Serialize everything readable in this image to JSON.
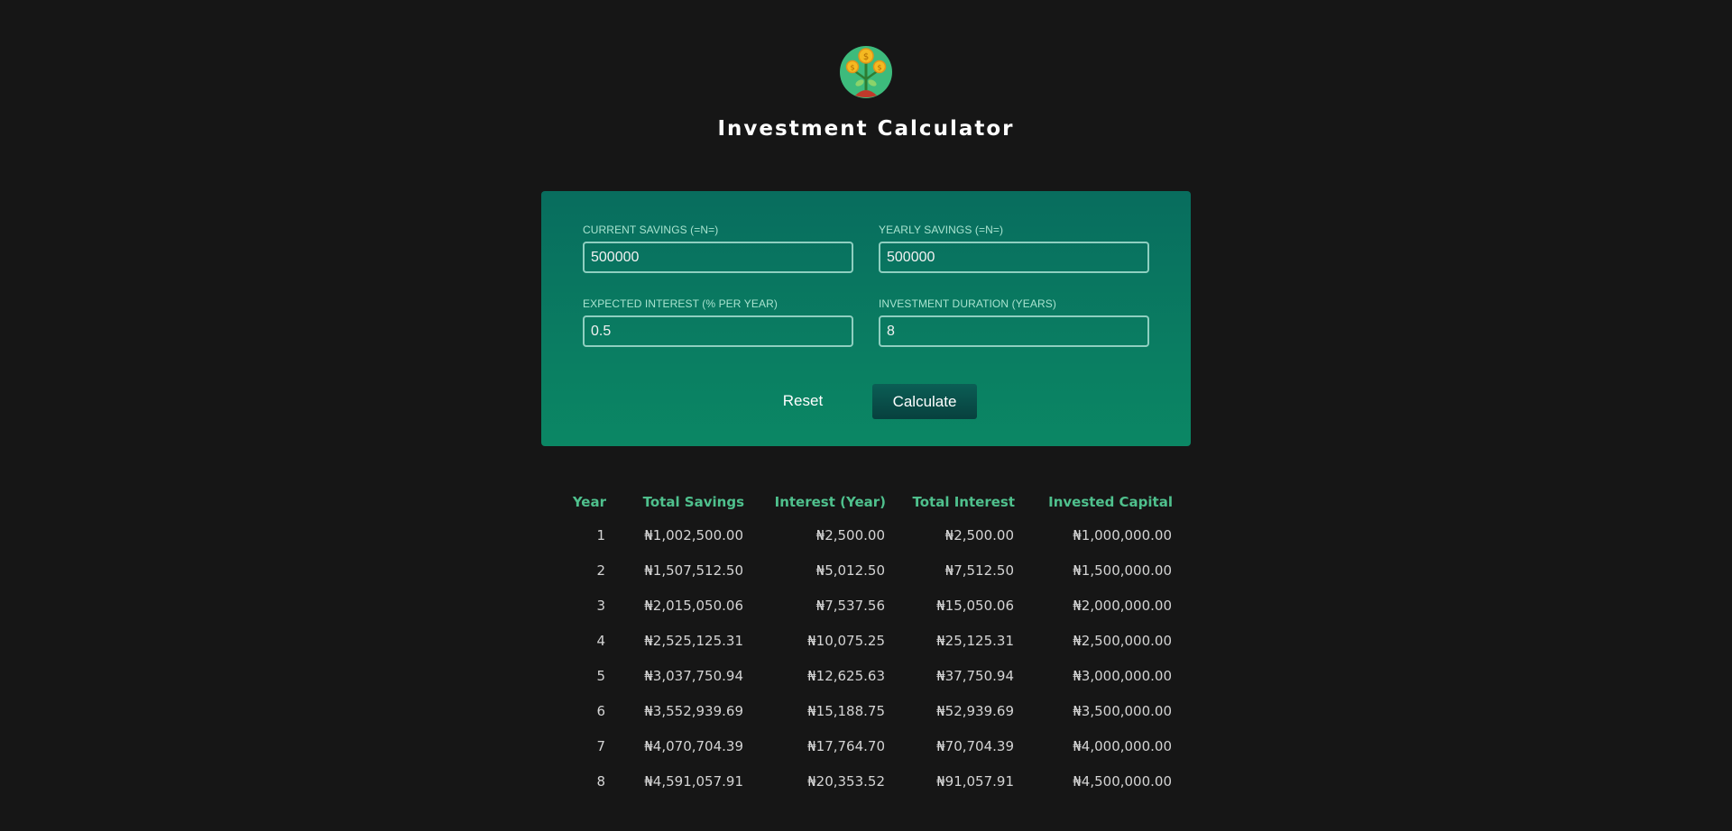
{
  "header": {
    "title": "Investment Calculator",
    "logo_icon": "money-plant-icon"
  },
  "form": {
    "current_savings": {
      "label": "CURRENT SAVINGS (=N=)",
      "value": "500000"
    },
    "yearly_savings": {
      "label": "YEARLY SAVINGS (=N=)",
      "value": "500000"
    },
    "expected_interest": {
      "label": "EXPECTED INTEREST (% PER YEAR)",
      "value": "0.5"
    },
    "investment_duration": {
      "label": "INVESTMENT DURATION (YEARS)",
      "value": "8"
    },
    "reset_label": "Reset",
    "calculate_label": "Calculate"
  },
  "colors": {
    "background": "#161616",
    "panel_top": "#086d5e",
    "panel_bottom": "#0b8764",
    "header_text": "#4fc08d"
  },
  "results": {
    "headers": [
      "Year",
      "Total Savings",
      "Interest (Year)",
      "Total Interest",
      "Invested Capital"
    ],
    "rows": [
      [
        "1",
        "₦1,002,500.00",
        "₦2,500.00",
        "₦2,500.00",
        "₦1,000,000.00"
      ],
      [
        "2",
        "₦1,507,512.50",
        "₦5,012.50",
        "₦7,512.50",
        "₦1,500,000.00"
      ],
      [
        "3",
        "₦2,015,050.06",
        "₦7,537.56",
        "₦15,050.06",
        "₦2,000,000.00"
      ],
      [
        "4",
        "₦2,525,125.31",
        "₦10,075.25",
        "₦25,125.31",
        "₦2,500,000.00"
      ],
      [
        "5",
        "₦3,037,750.94",
        "₦12,625.63",
        "₦37,750.94",
        "₦3,000,000.00"
      ],
      [
        "6",
        "₦3,552,939.69",
        "₦15,188.75",
        "₦52,939.69",
        "₦3,500,000.00"
      ],
      [
        "7",
        "₦4,070,704.39",
        "₦17,764.70",
        "₦70,704.39",
        "₦4,000,000.00"
      ],
      [
        "8",
        "₦4,591,057.91",
        "₦20,353.52",
        "₦91,057.91",
        "₦4,500,000.00"
      ]
    ]
  }
}
